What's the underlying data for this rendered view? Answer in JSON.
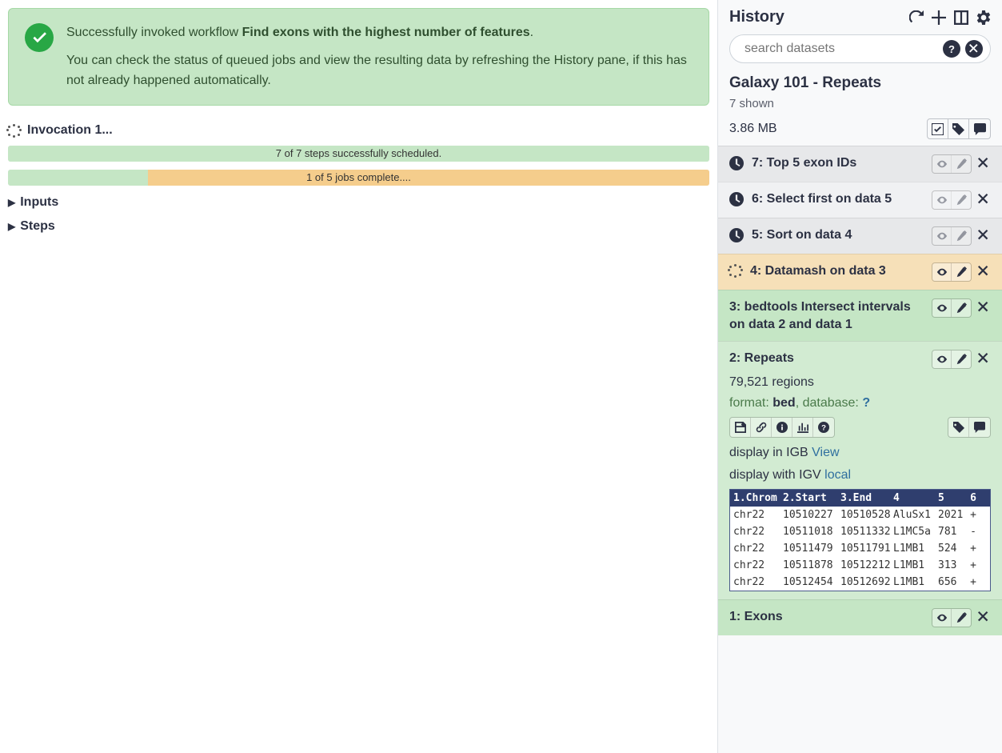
{
  "alert": {
    "prefix": "Successfully invoked workflow ",
    "workflow_name": "Find exons with the highest number of features",
    "suffix": ".",
    "body": "You can check the status of queued jobs and view the resulting data by refreshing the History pane, if this has not already happened automatically."
  },
  "invocation": {
    "label": "Invocation 1..."
  },
  "progress": {
    "steps_text": "7 of 7 steps successfully scheduled.",
    "jobs_text": "1 of 5 jobs complete....",
    "jobs_green_pct": 20,
    "jobs_orange_pct": 80
  },
  "expanders": {
    "inputs": "Inputs",
    "steps": "Steps"
  },
  "history": {
    "title": "History",
    "search_placeholder": "search datasets",
    "name": "Galaxy 101 - Repeats",
    "shown": "7 shown",
    "size": "3.86 MB",
    "items": [
      {
        "id": 7,
        "title": "7: Top 5 exon IDs",
        "state": "queued"
      },
      {
        "id": 6,
        "title": "6: Select first on data 5",
        "state": "queued-alt"
      },
      {
        "id": 5,
        "title": "5: Sort on data 4",
        "state": "queued"
      },
      {
        "id": 4,
        "title": "4: Datamash on data 3",
        "state": "running"
      },
      {
        "id": 3,
        "title": "3: bedtools Intersect intervals on data 2 and data 1",
        "state": "ok"
      },
      {
        "id": 2,
        "title": "2: Repeats",
        "state": "ok-alt",
        "expanded": true
      },
      {
        "id": 1,
        "title": "1: Exons",
        "state": "ok"
      }
    ],
    "expanded_item": {
      "regions": "79,521 regions",
      "format_label": "format: ",
      "format_value": "bed",
      "database_label": ",  database: ",
      "database_value": "?",
      "display_igb_label": "display in IGB ",
      "display_igb_link": "View",
      "display_igv_label": "display with IGV ",
      "display_igv_link": "local",
      "headers": [
        "1.Chrom",
        "2.Start",
        "3.End",
        "4",
        "5",
        "6"
      ],
      "rows": [
        [
          "chr22",
          "10510227",
          "10510528",
          "AluSx1",
          "2021",
          "+"
        ],
        [
          "chr22",
          "10511018",
          "10511332",
          "L1MC5a",
          "781",
          "-"
        ],
        [
          "chr22",
          "10511479",
          "10511791",
          "L1MB1",
          "524",
          "+"
        ],
        [
          "chr22",
          "10511878",
          "10512212",
          "L1MB1",
          "313",
          "+"
        ],
        [
          "chr22",
          "10512454",
          "10512692",
          "L1MB1",
          "656",
          "+"
        ]
      ]
    }
  }
}
